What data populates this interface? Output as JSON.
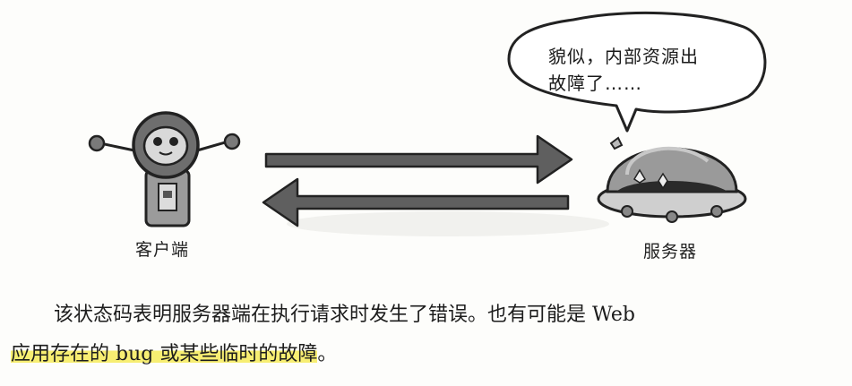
{
  "illustration": {
    "client_label": "客户端",
    "server_label": "服务器",
    "speech_bubble": "貌似，内部资源出\n故障了……"
  },
  "paragraph": {
    "line1": "该状态码表明服务器端在执行请求时发生了错误。也有可能是 Web",
    "line2_highlighted": "应用存在的 bug 或某些临时的故障",
    "line2_tail": "。"
  },
  "colors": {
    "arrow": "#5f5f5f",
    "highlight": "#f7ee72",
    "robot_head": "#6e6e6e",
    "server_dome": "#9a9a9a"
  }
}
